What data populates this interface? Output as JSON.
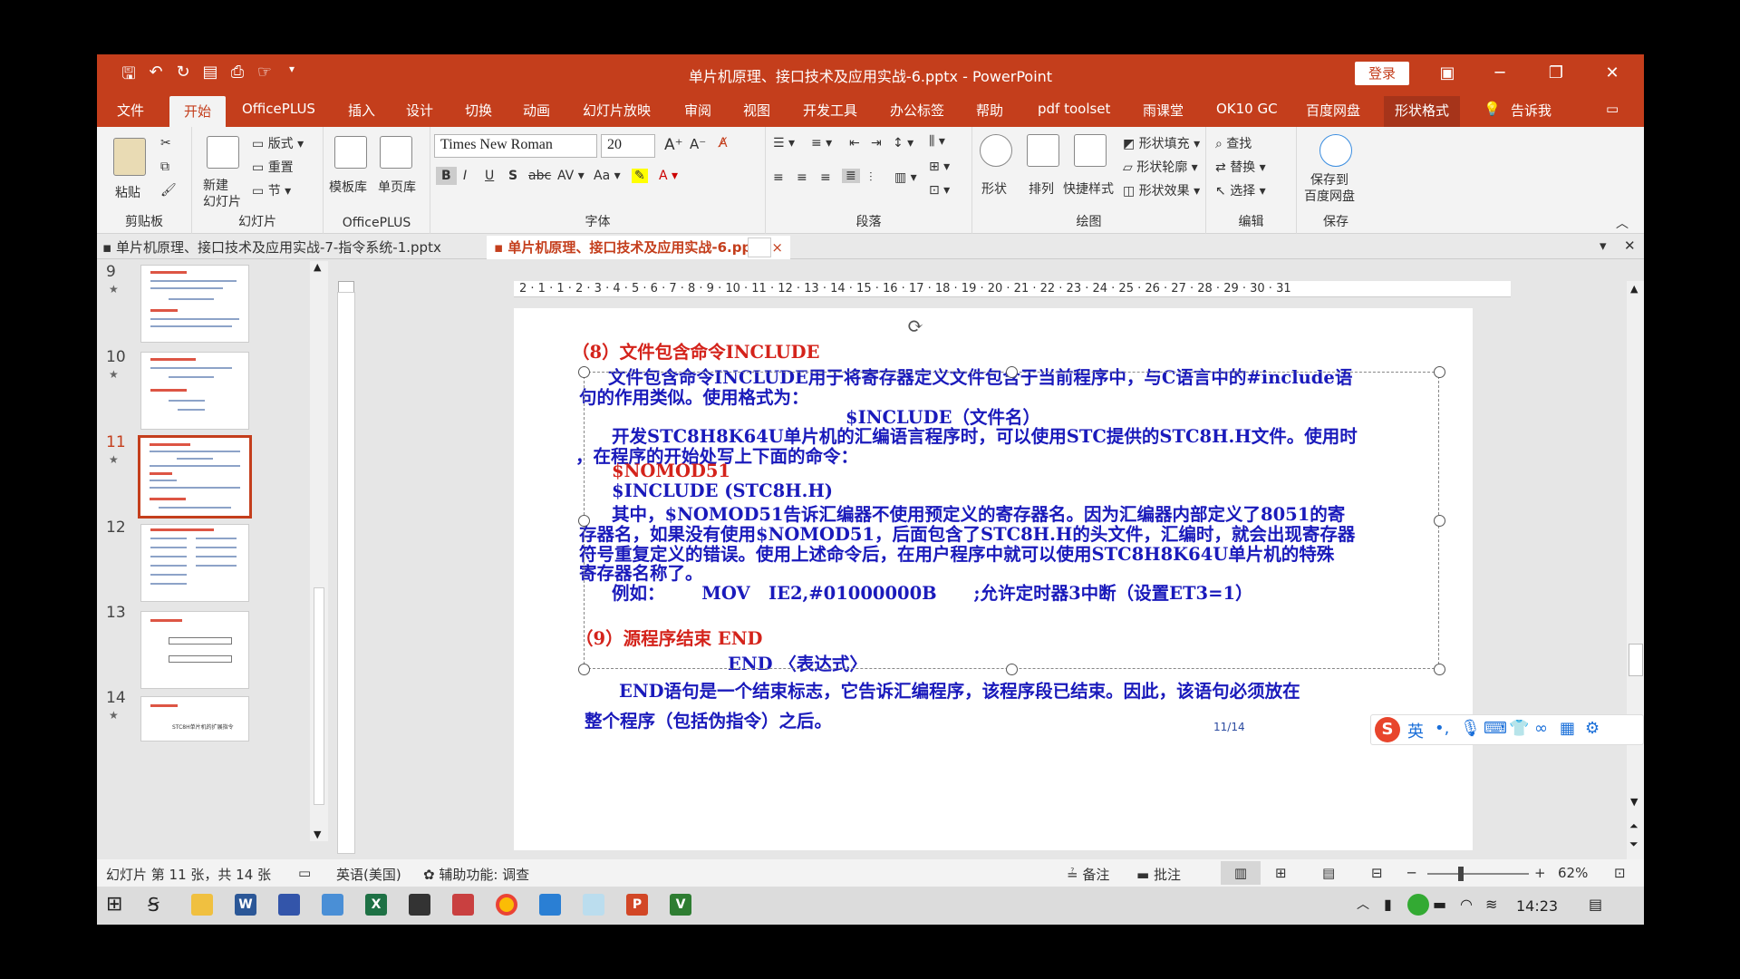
{
  "window": {
    "title": "单片机原理、接口技术及应用实战-6.pptx  -  PowerPoint",
    "login_label": "登录"
  },
  "tabs": [
    "文件",
    "开始",
    "OfficePLUS",
    "插入",
    "设计",
    "切换",
    "动画",
    "幻灯片放映",
    "审阅",
    "视图",
    "开发工具",
    "办公标签",
    "帮助",
    "pdf toolset",
    "雨课堂",
    "OK10 GC",
    "百度网盘",
    "形状格式"
  ],
  "tell_me": "告诉我",
  "ribbon": {
    "clipboard": {
      "label": "剪贴板",
      "paste": "粘贴"
    },
    "slides": {
      "label": "幻灯片",
      "new_slide": "新建\n幻灯片",
      "layout": "版式",
      "reset": "重置",
      "section": "节"
    },
    "officeplus": {
      "label": "OfficePLUS",
      "template": "模板库",
      "single": "单页库"
    },
    "font": {
      "label": "字体",
      "font_name": "Times New Roman",
      "font_size": "20"
    },
    "paragraph": {
      "label": "段落"
    },
    "drawing": {
      "label": "绘图",
      "shape": "形状",
      "arrange": "排列",
      "quick_style": "快捷样式",
      "fill": "形状填充",
      "outline": "形状轮廓",
      "effect": "形状效果"
    },
    "editing": {
      "label": "编辑",
      "find": "查找",
      "replace": "替换",
      "select": "选择"
    },
    "save": {
      "label": "保存",
      "save_baidu": "保存到\n百度网盘"
    }
  },
  "doc_tabs": [
    {
      "label": "单片机原理、接口技术及应用实战-7-指令系统-1.pptx",
      "active": false
    },
    {
      "label": "单片机原理、接口技术及应用实战-6.pptx",
      "active": true
    }
  ],
  "thumbnails": [
    {
      "num": "9",
      "star": "★"
    },
    {
      "num": "10",
      "star": "★"
    },
    {
      "num": "11",
      "star": "★",
      "selected": true
    },
    {
      "num": "12",
      "star": ""
    },
    {
      "num": "13",
      "star": ""
    },
    {
      "num": "14",
      "star": "★",
      "text": "STC8H单片机的扩展指令"
    }
  ],
  "hruler": "2 · 1 · 1 · 2 · 3 · 4 · 5 · 6 · 7 · 8 · 9 · 10 · 11 · 12 · 13 · 14 · 15 · 16 · 17 · 18 · 19 · 20 · 21 · 22 · 23 · 24 · 25 · 26 · 27 · 28 · 29 · 30 · 31",
  "slide": {
    "heading8": "（8）文件包含命令INCLUDE",
    "p1a": "文件包含命令INCLUDE用于将寄存器定义文件包含于当前程序中，与C语言中的#include语",
    "p1b": "句的作用类似。使用格式为：",
    "p1c": "$INCLUDE（文件名）",
    "p2a": "开发STC8H8K64U单片机的汇编语言程序时，可以使用STC提供的STC8H.H文件。使用时",
    "p2b": "，在程序的开始处写上下面的命令：",
    "code1": "$NOMOD51",
    "code2": "$INCLUDE (STC8H.H)",
    "p3a": "其中，$NOMOD51告诉汇编器不使用预定义的寄存器名。因为汇编器内部定义了8051的寄",
    "p3b": "存器名，如果没有使用$NOMOD51，后面包含了STC8H.H的头文件，汇编时，就会出现寄存器",
    "p3c": "符号重复定义的错误。使用上述命令后，在用户程序中就可以使用STC8H8K64U单片机的特殊",
    "p3d": "寄存器名称了。",
    "example": "例如：      MOV   IE2,#01000000B      ;允许定时器3中断（设置ET3=1）",
    "heading9": "（9）源程序结束 END",
    "end_syntax": "END  〈表达式〉",
    "p4a": "END语句是一个结束标志，它告诉汇编程序，该程序段已结束。因此，该语句必须放在",
    "p4b": "整个程序（包括伪指令）之后。",
    "page": "11/14"
  },
  "ime": {
    "lang": "英"
  },
  "status": {
    "slide_info": "幻灯片 第 11 张，共 14 张",
    "language": "英语(美国)",
    "accessibility": "辅助功能: 调查",
    "notes": "备注",
    "comments": "批注",
    "zoom": "62%"
  },
  "clock": "14:23",
  "colors": {
    "accent": "#c43e1c",
    "slide_red": "#d4231b",
    "slide_blue": "#1a1abb"
  }
}
